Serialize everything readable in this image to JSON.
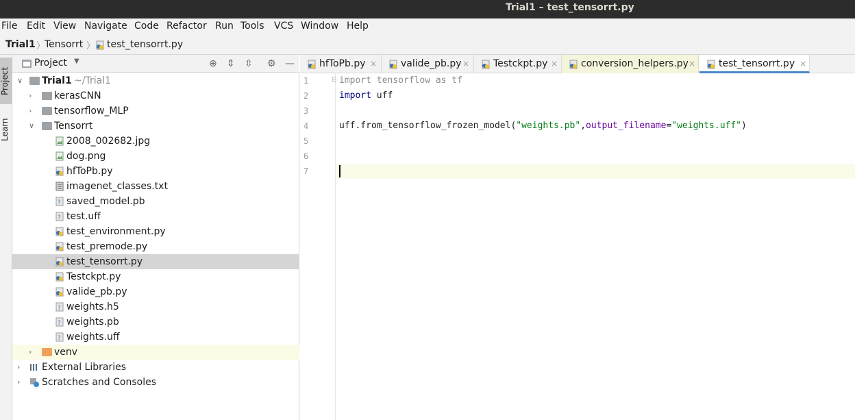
{
  "window": {
    "title": "Trial1 – test_tensorrt.py"
  },
  "menu": [
    "File",
    "Edit",
    "View",
    "Navigate",
    "Code",
    "Refactor",
    "Run",
    "Tools",
    "VCS",
    "Window",
    "Help"
  ],
  "breadcrumb": [
    "Trial1",
    "Tensorrt",
    "test_tensorrt.py"
  ],
  "side_tabs": {
    "project": "Project",
    "learn": "Learn"
  },
  "project_panel": {
    "title": "Project",
    "root": {
      "name": "Trial1",
      "path": "~/Trial1"
    },
    "folders": {
      "kerascnn": "kerasCNN",
      "tensorflow_mlp": "tensorflow_MLP",
      "tensorrt": "Tensorrt",
      "venv": "venv"
    },
    "files": [
      "2008_002682.jpg",
      "dog.png",
      "hfToPb.py",
      "imagenet_classes.txt",
      "saved_model.pb",
      "test.uff",
      "test_environment.py",
      "test_premode.py",
      "test_tensorrt.py",
      "Testckpt.py",
      "valide_pb.py",
      "weights.h5",
      "weights.pb",
      "weights.uff"
    ],
    "external_libraries": "External Libraries",
    "scratches": "Scratches and Consoles"
  },
  "tabs": [
    "hfToPb.py",
    "valide_pb.py",
    "Testckpt.py",
    "conversion_helpers.py",
    "test_tensorrt.py"
  ],
  "tab_close": "×",
  "active_tab": "test_tensorrt.py",
  "line_numbers": [
    "1",
    "2",
    "3",
    "4",
    "5",
    "6",
    "7"
  ],
  "code": {
    "line1": "import tensorflow as tf",
    "line2_kw": "import",
    "line2_rest": " uff",
    "line4_a": "uff.from_tensorflow_frozen_model(",
    "line4_str1": "\"weights.pb\"",
    "line4_comma": ",",
    "line4_param": "output_filename",
    "line4_eq": "=",
    "line4_str2": "\"weights.uff\"",
    "line4_end": ")"
  },
  "icons": {
    "header": [
      "target-icon",
      "expand-all-icon",
      "collapse-all-icon",
      "gear-icon",
      "minimize-icon"
    ]
  }
}
